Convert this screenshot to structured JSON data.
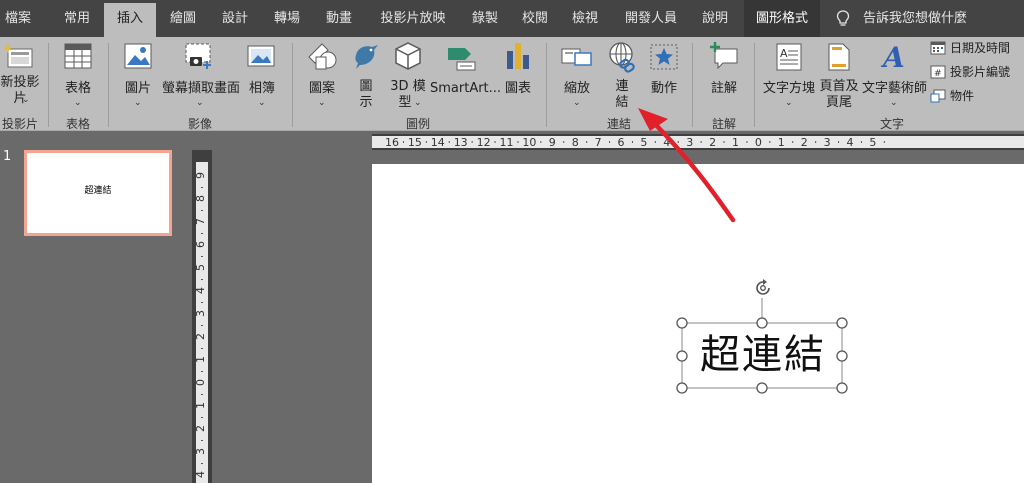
{
  "tabs": [
    {
      "label": "檔案"
    },
    {
      "label": "常用"
    },
    {
      "label": "插入"
    },
    {
      "label": "繪圖"
    },
    {
      "label": "設計"
    },
    {
      "label": "轉場"
    },
    {
      "label": "動畫"
    },
    {
      "label": "投影片放映"
    },
    {
      "label": "錄製"
    },
    {
      "label": "校閱"
    },
    {
      "label": "檢視"
    },
    {
      "label": "開發人員"
    },
    {
      "label": "說明"
    },
    {
      "label": "圖形格式"
    }
  ],
  "active_tab": "插入",
  "tell_me": "告訴我您想做什麼",
  "ribbon": {
    "new_slide": {
      "line1": "新投影",
      "line2": "片"
    },
    "table": "表格",
    "picture": "圖片",
    "screenshot": "螢幕擷取畫面",
    "album": "相簿",
    "shapes": "圖案",
    "icons": {
      "line1": "圖",
      "line2": "示"
    },
    "model3d": {
      "line1": "3D 模",
      "line2": "型"
    },
    "smartart": "SmartArt...",
    "chart": "圖表",
    "zoom": "縮放",
    "link": {
      "line1": "連",
      "line2": "結"
    },
    "action": "動作",
    "comment": "註解",
    "textbox": "文字方塊",
    "header_footer": {
      "line1": "頁首及",
      "line2": "頁尾"
    },
    "wordart": "文字藝術師",
    "date_time": "日期及時間",
    "slide_number": "投影片編號",
    "object": "物件",
    "groups": {
      "slides": "投影片",
      "tables": "表格",
      "images": "影像",
      "illustrations": "圖例",
      "links": "連結",
      "comments": "註解",
      "text": "文字"
    }
  },
  "slide_panel": {
    "number": "1",
    "thumb_text": "超連結"
  },
  "slide": {
    "text": "超連結"
  },
  "hruler": [
    "16",
    "15",
    "14",
    "13",
    "12",
    "11",
    "10",
    "9",
    "8",
    "7",
    "6",
    "5",
    "4",
    "3",
    "2",
    "1",
    "0",
    "1",
    "2",
    "3",
    "4",
    "5"
  ],
  "vruler": [
    "9",
    "8",
    "7",
    "6",
    "5",
    "4",
    "3",
    "2",
    "1",
    "0",
    "1",
    "2",
    "3",
    "4"
  ],
  "colors": {
    "annotation_arrow": "#e0202a",
    "thumb_border": "#f2a691",
    "ribbon_bg": "#bdbdbd",
    "tabbar_bg": "#444444"
  }
}
